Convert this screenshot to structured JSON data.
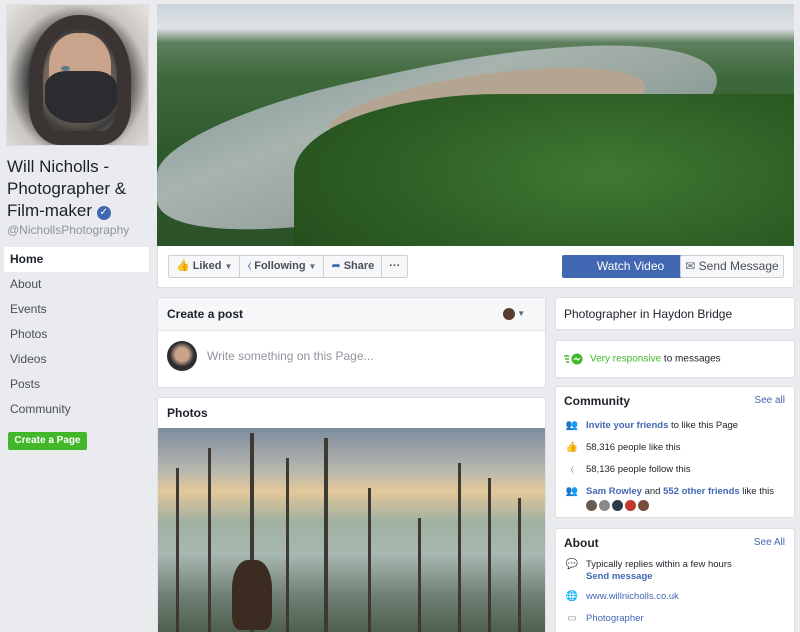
{
  "profile": {
    "name": "Will Nicholls - Photographer & Film-maker",
    "verified_glyph": "✓",
    "handle": "@NichollsPhotography"
  },
  "nav": {
    "items": [
      {
        "label": "Home",
        "active": true
      },
      {
        "label": "About"
      },
      {
        "label": "Events"
      },
      {
        "label": "Photos"
      },
      {
        "label": "Videos"
      },
      {
        "label": "Posts"
      },
      {
        "label": "Community"
      }
    ],
    "create_page_label": "Create a Page"
  },
  "actions": {
    "liked_label": "Liked",
    "following_label": "Following",
    "share_label": "Share",
    "more_label": "···",
    "watch_video_label": "Watch Video",
    "send_message_label": "Send Message"
  },
  "create_post": {
    "title": "Create a post",
    "placeholder": "Write something on this Page..."
  },
  "photos": {
    "title": "Photos"
  },
  "right": {
    "category": "Photographer in Haydon Bridge",
    "responsiveness_highlight": "Very responsive",
    "responsiveness_rest": " to messages",
    "community": {
      "title": "Community",
      "see_all": "See all",
      "invite_link": "Invite your friends",
      "invite_rest": " to like this Page",
      "likes_text": "58,316 people like this",
      "follows_text": "58,136 people follow this",
      "friend_name": "Sam Rowley",
      "friends_and": " and ",
      "friends_count": "552 other friends",
      "friends_rest": " like this"
    },
    "about": {
      "title": "About",
      "see_all": "See All",
      "reply_text": "Typically replies within a few hours",
      "send_message_link": "Send message",
      "website": "www.willnicholls.co.uk",
      "category_link": "Photographer"
    }
  },
  "colors": {
    "brand_blue": "#4267b2",
    "create_green": "#42b72a",
    "background": "#e9ebee"
  }
}
